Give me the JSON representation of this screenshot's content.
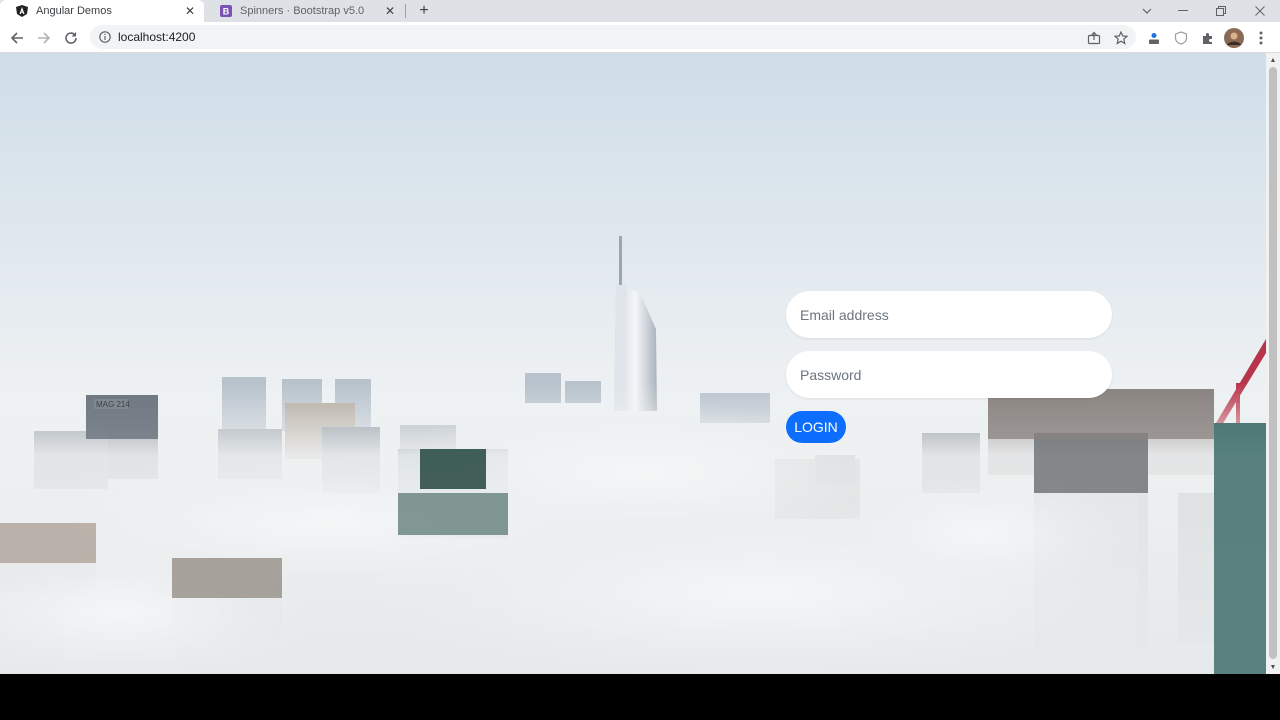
{
  "browser": {
    "tabs": [
      {
        "title": "Angular Demos",
        "favicon": "angular-icon",
        "active": true
      },
      {
        "title": "Spinners · Bootstrap v5.0",
        "favicon": "bootstrap-icon",
        "active": false
      }
    ],
    "address": "localhost:4200",
    "icons": [
      "back-icon",
      "forward-icon",
      "reload-icon",
      "info-icon",
      "share-icon",
      "star-icon",
      "profile-icon",
      "shield-icon",
      "extensions-icon",
      "avatar",
      "menu-icon"
    ]
  },
  "colors": {
    "accent": "#0d6efd",
    "tab_strip": "#dee1e6",
    "sky_top": "#cfdde8",
    "fog": "#eef1f3"
  },
  "login": {
    "email_placeholder": "Email address",
    "password_placeholder": "Password",
    "button_label": "LOGIN"
  },
  "background": {
    "building_sign": "MAG 214"
  }
}
